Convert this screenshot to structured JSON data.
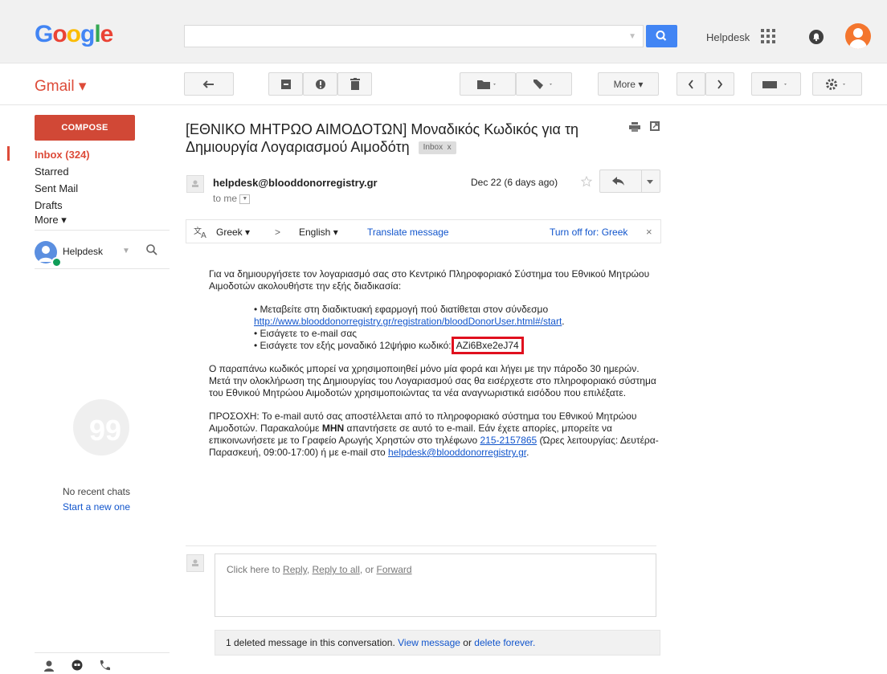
{
  "header": {
    "logo": [
      "G",
      "o",
      "o",
      "g",
      "l",
      "e"
    ],
    "logo_colors": [
      "#4285f4",
      "#ea4335",
      "#fbbc05",
      "#4285f4",
      "#34a853",
      "#ea4335"
    ],
    "search_placeholder": "",
    "user_name": "Helpdesk"
  },
  "toolbar": {
    "app_label": "Gmail ▾",
    "more_label": "More ▾"
  },
  "sidebar": {
    "compose": "COMPOSE",
    "items": [
      {
        "label": "Inbox (324)"
      },
      {
        "label": "Starred"
      },
      {
        "label": "Sent Mail"
      },
      {
        "label": "Drafts"
      },
      {
        "label": "More ▾"
      }
    ],
    "hangouts_user": "Helpdesk",
    "no_chats": "No recent chats",
    "start_new": "Start a new one"
  },
  "email": {
    "subject": "[ΕΘΝΙΚΟ ΜΗΤΡΩΟ ΑΙΜΟΔΟΤΩΝ] Μοναδικός Κωδικός για τη Δημιουργία Λογαριασμού Αιμοδότη",
    "inbox_tag": "Inbox",
    "inbox_tag_close": "x",
    "sender": "helpdesk@blooddonorregistry.gr",
    "to": "to me",
    "date": "Dec 22 (6 days ago)"
  },
  "translate": {
    "from_lang": "Greek ▾",
    "arrow": ">",
    "to_lang": "English ▾",
    "translate_link": "Translate message",
    "turn_off": "Turn off for: Greek",
    "close": "×"
  },
  "body": {
    "p1": "Για να δημιουργήσετε τον λογαριασμό σας στο Κεντρικό Πληροφοριακό Σύστημα του Εθνικού Μητρώου Αιμοδοτών ακολουθήστε την εξής διαδικασία:",
    "li1": "Μεταβείτε στη διαδικτυακή εφαρμογή πού διατίθεται στον σύνδεσμο",
    "li1_link": "http://www.blooddonorregistry.gr/registration/bloodDonorUser.html#/start",
    "li2": "Εισάγετε το e-mail σας",
    "li3": "Εισάγετε τον εξής μοναδικό 12ψήφιο κωδικό:",
    "code": "AZi6Bxe2eJ74",
    "p2": "Ο παραπάνω κωδικός μπορεί να χρησιμοποιηθεί μόνο μία φορά και λήγει με την πάροδο 30 ημερών. Μετά την ολοκλήρωση της Δημιουργίας του Λογαριασμού σας θα εισέρχεστε στο πληροφοριακό σύστημα του Εθνικού Μητρώου Αιμοδοτών χρησιμοποιώντας τα νέα αναγνωριστικά εισόδου που επιλέξατε.",
    "p3_a": "ΠΡΟΣΟΧΗ: Το e-mail αυτό σας αποστέλλεται από το πληροφοριακό σύστημα του Εθνικού Μητρώου Αιμοδοτών. Παρακαλούμε ",
    "p3_bold": "ΜΗΝ",
    "p3_b": " απαντήσετε σε αυτό το e-mail. Εάν έχετε απορίες, μπορείτε να επικοινωνήσετε με το Γραφείο Αρωγής Χρηστών στο τηλέφωνο ",
    "p3_phone": "215-2157865",
    "p3_c": " (Ώρες λειτουργίας: Δευτέρα-Παρασκευή, 09:00-17:00) ή με e-mail στο ",
    "p3_email": "helpdesk@blooddonorregistry.gr",
    "p3_d": "."
  },
  "reply": {
    "prefix": "Click here to ",
    "reply": "Reply",
    "sep1": ", ",
    "reply_all": "Reply to all",
    "sep2": ", or ",
    "forward": "Forward"
  },
  "deleted": {
    "text": "1 deleted message in this conversation. ",
    "view": "View message",
    "or": " or ",
    "delete": "delete forever."
  }
}
